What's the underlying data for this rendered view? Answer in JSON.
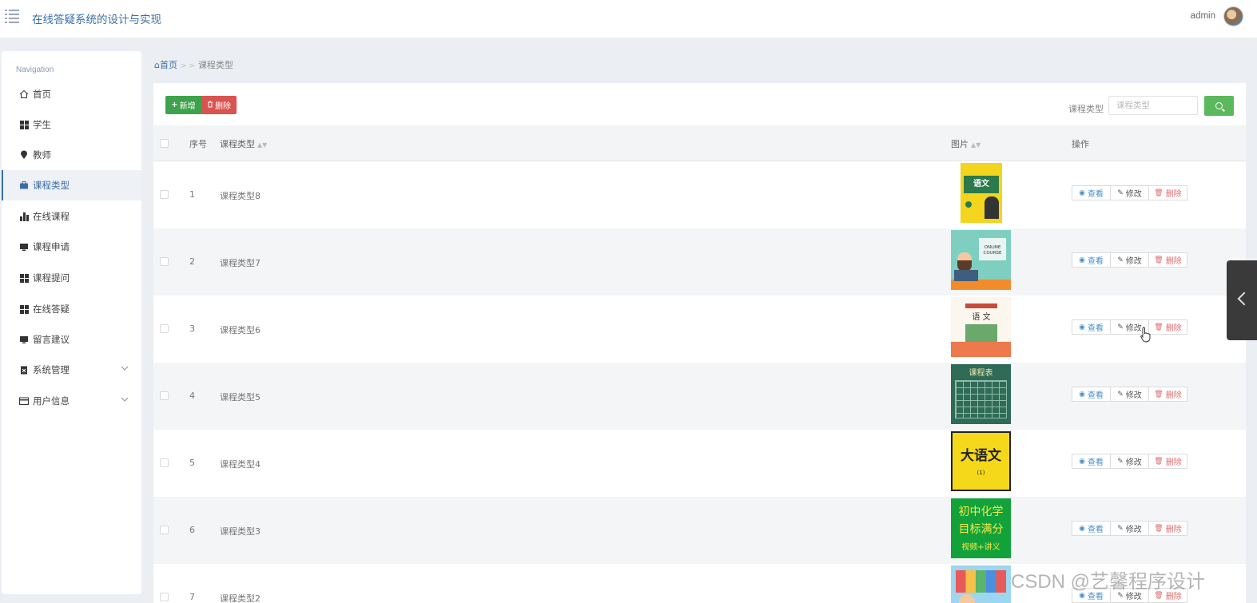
{
  "header": {
    "app_title": "在线答疑系统的设计与实现",
    "user_name": "admin",
    "menu_icon": "menu-icon"
  },
  "sidebar": {
    "header": "Navigation",
    "items": [
      {
        "label": "首页",
        "icon": "home-icon",
        "active": false
      },
      {
        "label": "学生",
        "icon": "grid-icon",
        "active": false
      },
      {
        "label": "教师",
        "icon": "pin-icon",
        "active": false
      },
      {
        "label": "课程类型",
        "icon": "briefcase-icon",
        "active": true
      },
      {
        "label": "在线课程",
        "icon": "bar-chart-icon",
        "active": false
      },
      {
        "label": "课程申请",
        "icon": "monitor-icon",
        "active": false
      },
      {
        "label": "课程提问",
        "icon": "grid-icon",
        "active": false
      },
      {
        "label": "在线答疑",
        "icon": "grid-icon",
        "active": false
      },
      {
        "label": "留言建议",
        "icon": "monitor-icon",
        "active": false
      },
      {
        "label": "系统管理",
        "icon": "clipboard-icon",
        "active": false,
        "expandable": true
      },
      {
        "label": "用户信息",
        "icon": "card-icon",
        "active": false,
        "expandable": true
      }
    ]
  },
  "breadcrumb": {
    "home": "首页",
    "separator": "> >",
    "current": "课程类型"
  },
  "toolbar": {
    "add_label": "新增",
    "delete_label": "删除",
    "search_label": "课程类型",
    "search_placeholder": "课程类型"
  },
  "table": {
    "columns": [
      "序号",
      "课程类型",
      "图片",
      "操作"
    ],
    "rows": [
      {
        "index": "1",
        "name": "课程类型8",
        "image": "yellow-textbook-cover"
      },
      {
        "index": "2",
        "name": "课程类型7",
        "image": "online-course-illustration"
      },
      {
        "index": "3",
        "name": "课程类型6",
        "image": "chinese-textbook-cover"
      },
      {
        "index": "4",
        "name": "课程类型5",
        "image": "timetable-chalkboard"
      },
      {
        "index": "5",
        "name": "课程类型4",
        "image": "yellow-chinese-poster"
      },
      {
        "index": "6",
        "name": "课程类型3",
        "image": "green-chemistry-poster"
      },
      {
        "index": "7",
        "name": "课程类型2",
        "image": "blue-kids-poster"
      }
    ],
    "actions": {
      "view": "查看",
      "edit": "修改",
      "delete": "删除"
    }
  },
  "thumb_text": {
    "t1_big": "语文",
    "t2_line1": "ONLINE",
    "t2_line2": "COURSE",
    "t3": "语 文",
    "t4": "课程表",
    "t5": "大语文",
    "t5_sub": "(1)",
    "t6_l1": "初中化学",
    "t6_l2": "目标满分",
    "t6_l3": "视频+讲义"
  },
  "watermark": "CSDN @艺馨程序设计",
  "colors": {
    "accent": "#3a6ea5",
    "add_button": "#3ca24b",
    "delete_button": "#d9534f",
    "search_button": "#5cb85c"
  }
}
